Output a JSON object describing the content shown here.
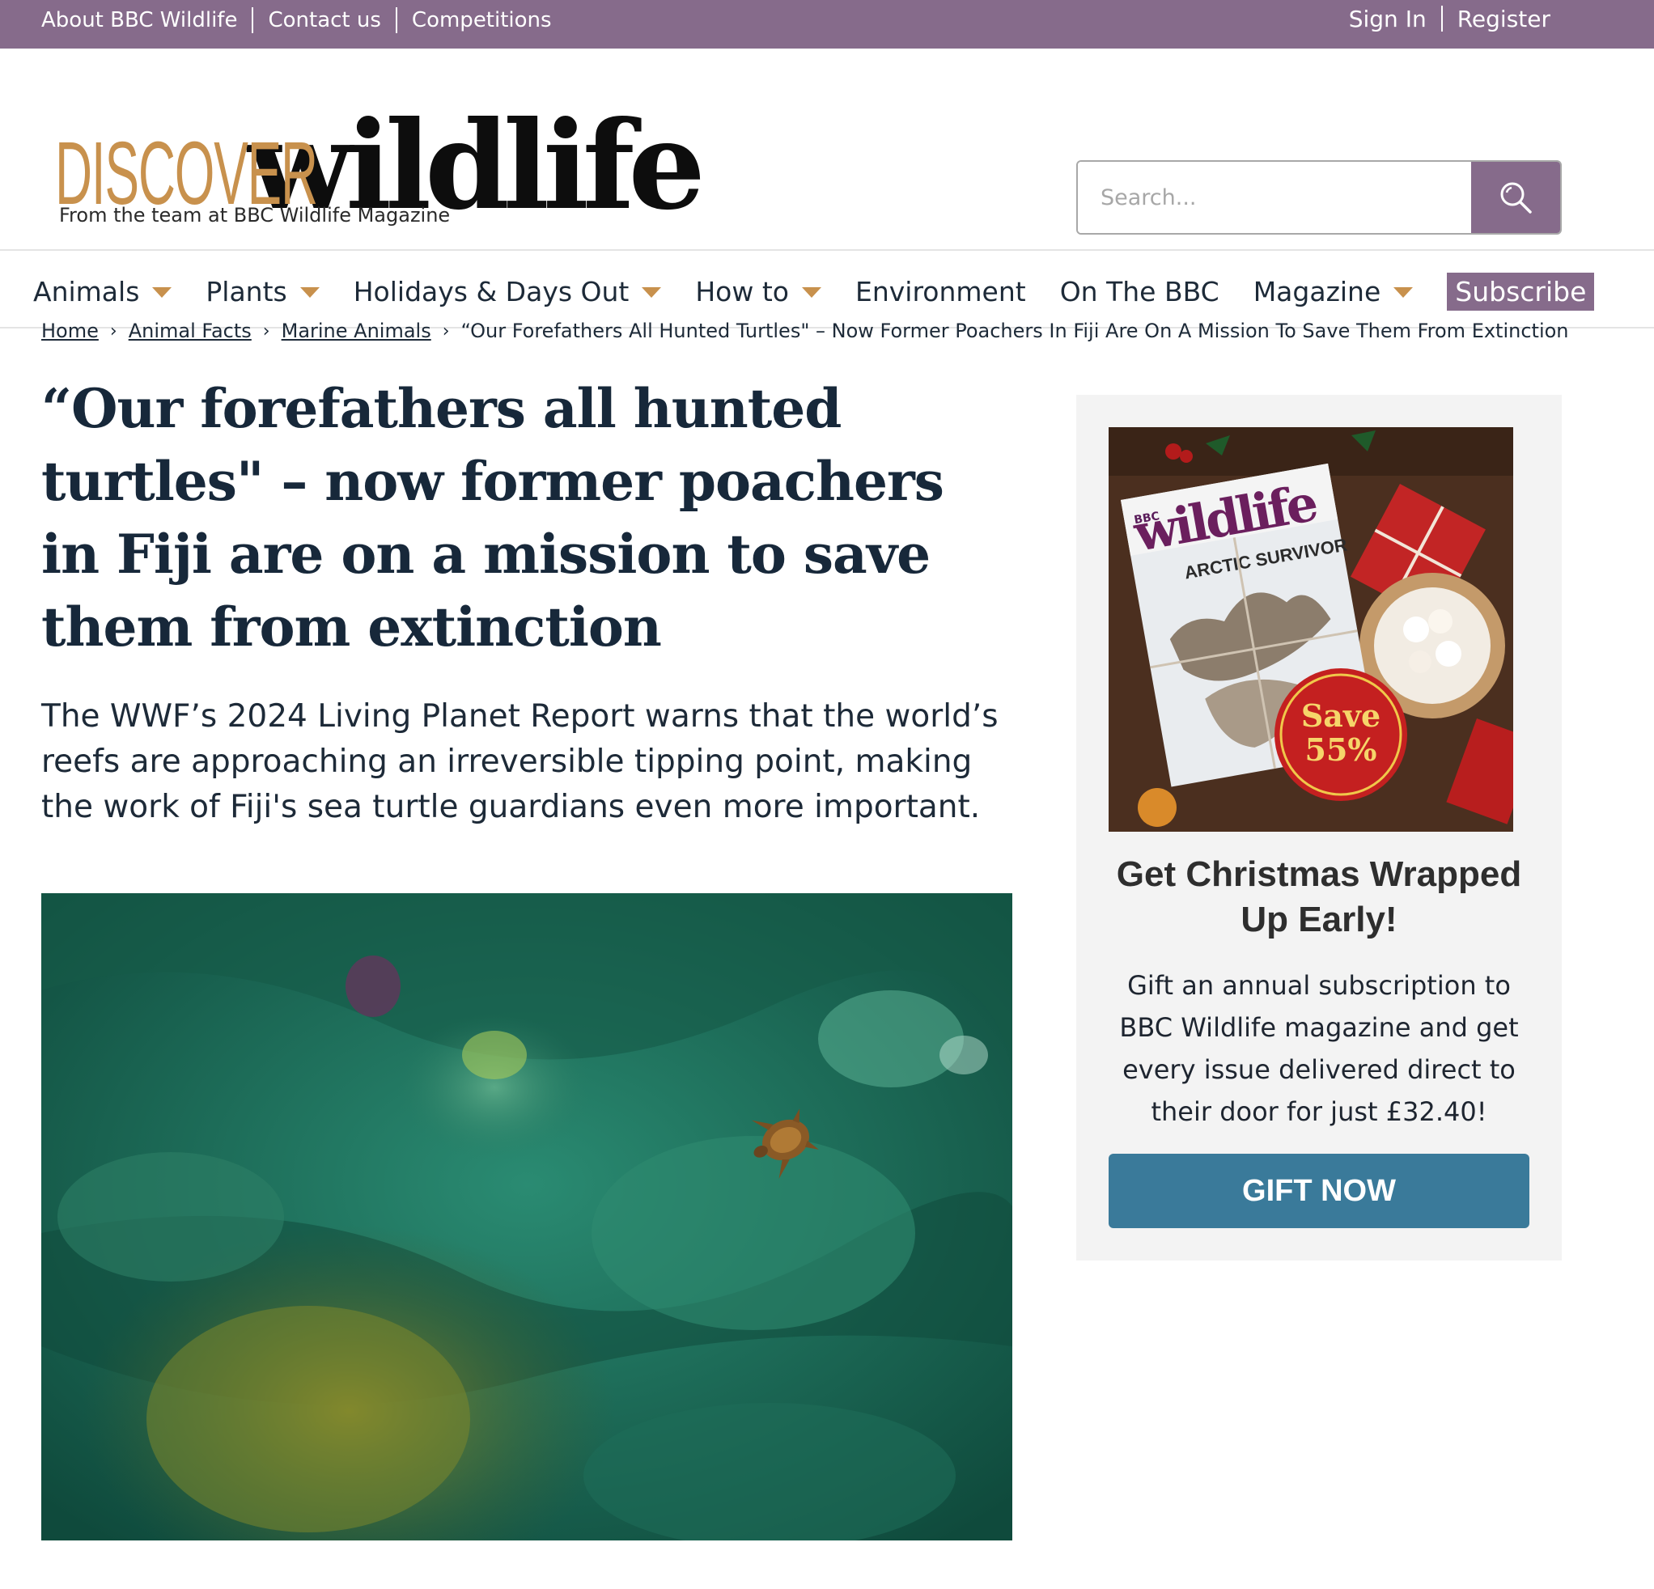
{
  "utility_nav": {
    "left_links": [
      "About BBC Wildlife",
      "Contact us",
      "Competitions"
    ],
    "sign_in": "Sign In",
    "register": "Register"
  },
  "brand": {
    "logo_discover": "DISCOVER",
    "logo_wildlife": "wildlife",
    "tagline": "From the team at BBC Wildlife Magazine"
  },
  "search": {
    "placeholder": "Search..."
  },
  "main_nav": {
    "items": [
      {
        "label": "Animals",
        "has_dropdown": true
      },
      {
        "label": "Plants",
        "has_dropdown": true
      },
      {
        "label": "Holidays & Days Out",
        "has_dropdown": true
      },
      {
        "label": "How to",
        "has_dropdown": true
      },
      {
        "label": "Environment",
        "has_dropdown": false
      },
      {
        "label": "On The BBC",
        "has_dropdown": false
      },
      {
        "label": "Magazine",
        "has_dropdown": true
      }
    ],
    "subscribe": "Subscribe"
  },
  "breadcrumb": {
    "links": [
      "Home",
      "Animal Facts",
      "Marine Animals"
    ],
    "current": "“Our Forefathers All Hunted Turtles\" – Now Former Poachers In Fiji Are On A Mission To Save Them From Extinction"
  },
  "article": {
    "title": "“Our forefathers all hunted turtles\" – now former poachers in Fiji are on a mission to save them from extinction",
    "standfirst": "The WWF’s 2024 Living Planet Report warns that the world’s reefs are approaching an irreversible tipping point, making the work of Fiji's sea turtle guardians even more important."
  },
  "promo": {
    "magazine_title": "wildlife",
    "magazine_bbc": "BBC",
    "magazine_cover_line": "ARCTIC SURVIVOR",
    "save_badge_line1": "Save",
    "save_badge_line2": "55%",
    "heading": "Get Christmas Wrapped Up Early!",
    "text": "Gift an annual subscription to BBC Wildlife magazine and get every issue delivered direct to their door for just £32.40!",
    "button": "GIFT NOW"
  },
  "colors": {
    "brand_purple": "#866b8b",
    "brand_gold": "#c8914d",
    "headline_navy": "#17283a",
    "button_teal": "#3a7a9a"
  },
  "icons": {
    "search": "magnifier-icon",
    "nav_dropdown": "caret-down-icon",
    "breadcrumb_separator": "chevron-right-icon"
  }
}
